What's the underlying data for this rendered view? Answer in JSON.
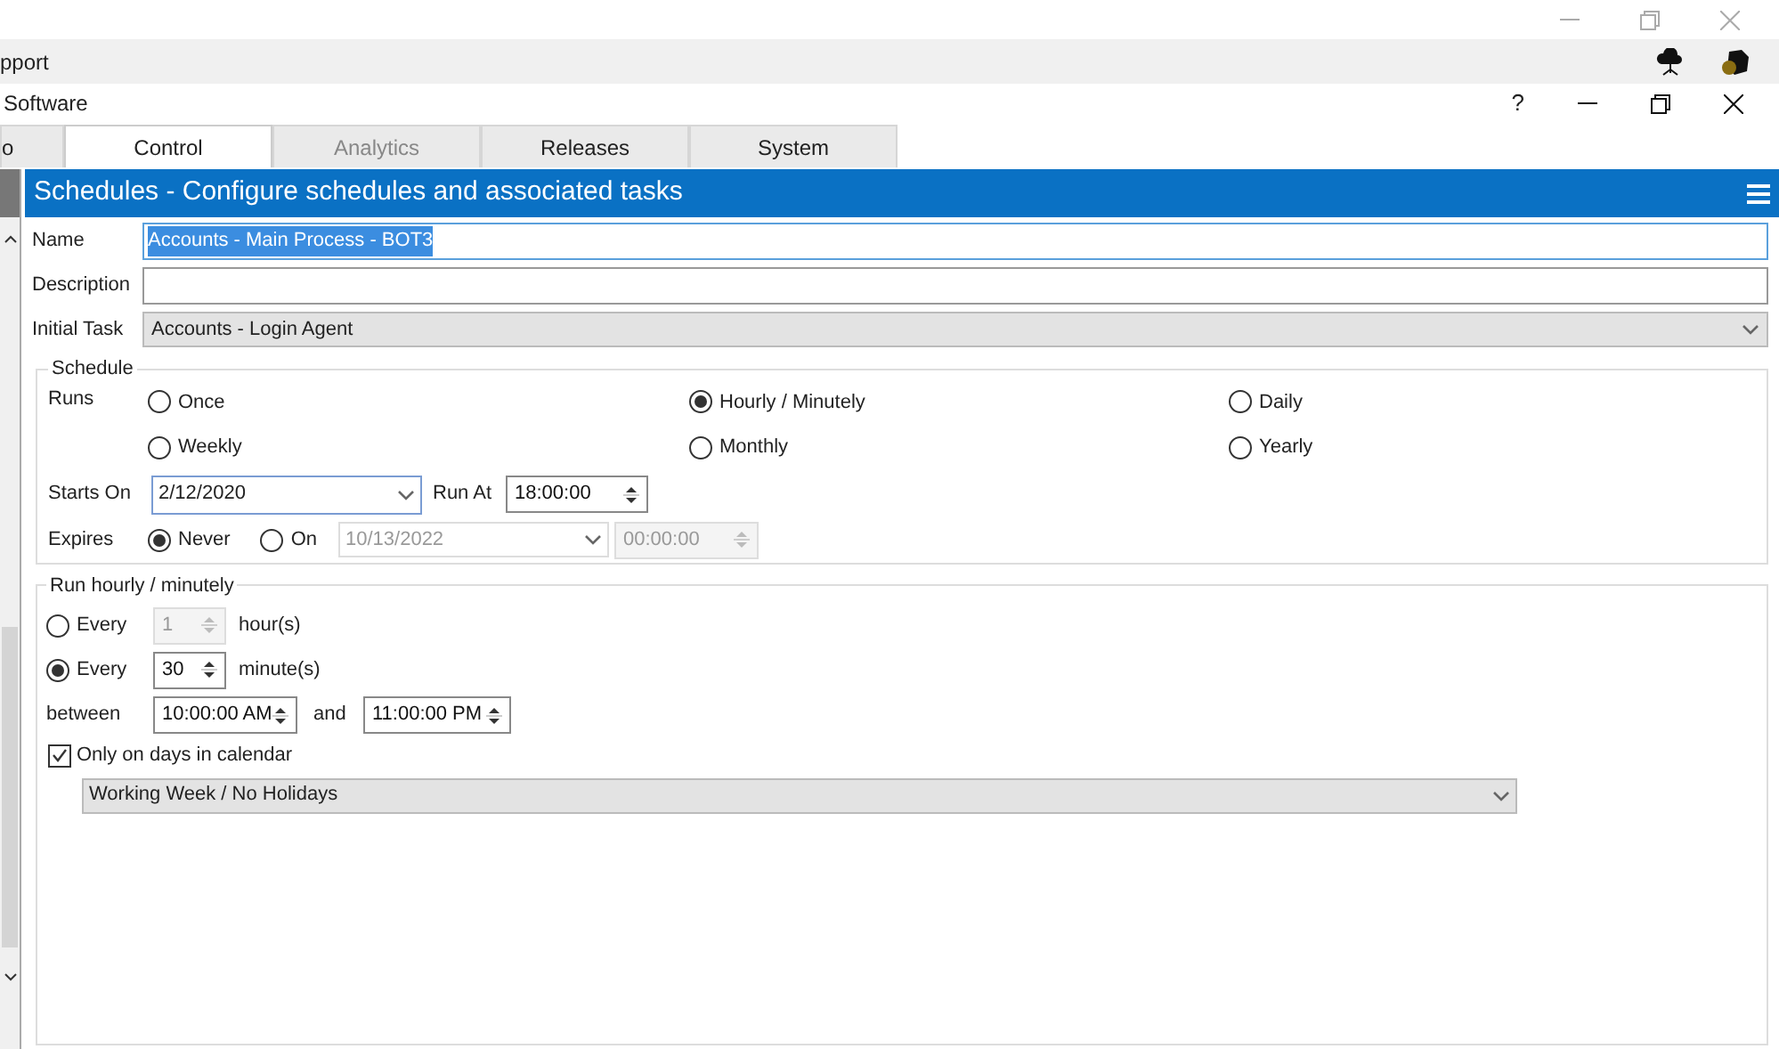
{
  "menu_bar": {
    "label": "pport"
  },
  "app_bar": {
    "title": "Software",
    "help": "?"
  },
  "tabs": [
    {
      "label": "o",
      "selected": false,
      "disabled": false
    },
    {
      "label": "Control",
      "selected": true,
      "disabled": false
    },
    {
      "label": "Analytics",
      "selected": false,
      "disabled": true
    },
    {
      "label": "Releases",
      "selected": false,
      "disabled": false
    },
    {
      "label": "System",
      "selected": false,
      "disabled": false
    }
  ],
  "panel": {
    "title": "Schedules - Configure schedules and associated tasks"
  },
  "fields": {
    "name": {
      "label": "Name",
      "value": "Accounts - Main Process - BOT3",
      "text_selected": true
    },
    "description": {
      "label": "Description"
    },
    "initial_task": {
      "label": "Initial Task",
      "value": "Accounts - Login Agent"
    }
  },
  "schedule": {
    "title": "Schedule",
    "runs_label": "Runs",
    "runs": [
      {
        "label": "Once",
        "selected": false
      },
      {
        "label": "Hourly / Minutely",
        "selected": true
      },
      {
        "label": "Daily",
        "selected": false
      },
      {
        "label": "Weekly",
        "selected": false
      },
      {
        "label": "Monthly",
        "selected": false
      },
      {
        "label": "Yearly",
        "selected": false
      }
    ],
    "starts_on": {
      "label": "Starts On",
      "value": "2/12/2020"
    },
    "run_at": {
      "label": "Run At",
      "value": "18:00:00"
    },
    "expires": {
      "label": "Expires",
      "options": [
        {
          "label": "Never",
          "selected": true
        },
        {
          "label": "On",
          "selected": false
        }
      ],
      "date": "10/13/2022",
      "time": "00:00:00",
      "disabled": true
    }
  },
  "hourly": {
    "title": "Run hourly / minutely",
    "every": [
      {
        "label": "Every",
        "selected": false,
        "value": "1",
        "unit": "hour(s)",
        "disabled": true
      },
      {
        "label": "Every",
        "selected": true,
        "value": "30",
        "unit": "minute(s)",
        "disabled": false
      }
    ],
    "between": {
      "label": "between",
      "from": "10:00:00 AM",
      "and": "and",
      "to": "11:00:00 PM"
    },
    "calendar": {
      "label": "Only on days in calendar",
      "checked": true,
      "value": "Working Week / No Holidays"
    }
  }
}
